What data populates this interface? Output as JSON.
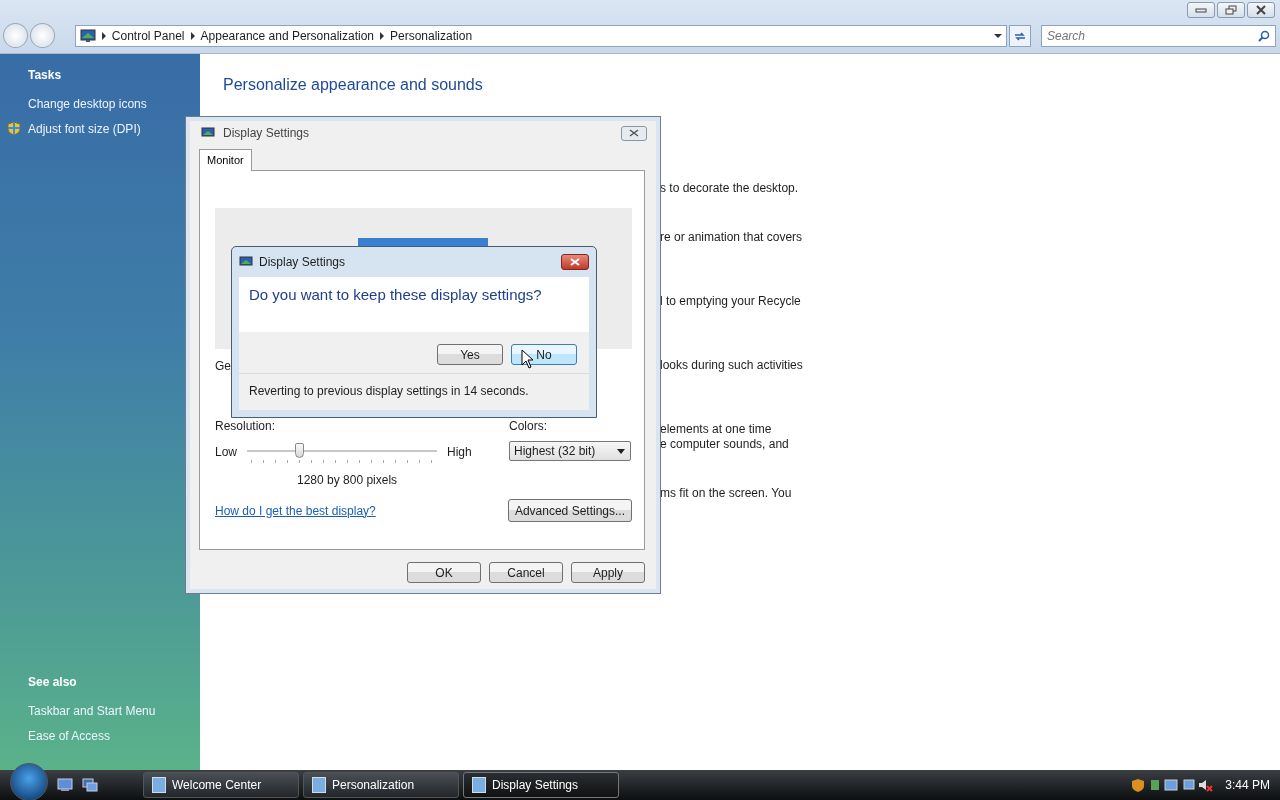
{
  "address_bar": {
    "breadcrumb": [
      "Control Panel",
      "Appearance and Personalization",
      "Personalization"
    ],
    "search": {
      "placeholder": "Search"
    }
  },
  "sidebar": {
    "sections": [
      {
        "title": "Tasks",
        "items": [
          {
            "label": "Change desktop icons",
            "kind": "link"
          },
          {
            "label": "Adjust font size (DPI)",
            "kind": "shield"
          }
        ]
      },
      {
        "title": "See also",
        "items": [
          {
            "label": "Taskbar and Start Menu",
            "kind": "link"
          },
          {
            "label": "Ease of Access",
            "kind": "link"
          }
        ]
      }
    ]
  },
  "main": {
    "heading": "Personalize appearance and sounds",
    "paragraphs": [
      [
        "s to decorate the desktop."
      ],
      [
        "re or animation that covers"
      ],
      [
        "l to emptying your Recycle"
      ],
      [
        "looks during such activities"
      ],
      [
        "elements at one time",
        "e computer sounds, and"
      ],
      [
        "ms fit on the screen. You"
      ]
    ]
  },
  "display_settings": {
    "title": "Display Settings",
    "tabs": [
      {
        "label": "Monitor"
      }
    ],
    "partial_label": "Ge",
    "resolution": {
      "label": "Resolution:",
      "low": "Low",
      "high": "High",
      "level": 0.28,
      "reading": "1280 by 800 pixels"
    },
    "colors": {
      "label": "Colors:",
      "value": "Highest (32 bit)"
    },
    "help_link": "How do I get the best display?",
    "advanced_button": "Advanced Settings...",
    "buttons": [
      "OK",
      "Cancel",
      "Apply"
    ]
  },
  "confirm": {
    "title": "Display Settings",
    "question": "Do you want to keep these display settings?",
    "buttons": [
      {
        "label": "Yes",
        "selected": false
      },
      {
        "label": "No",
        "selected": true
      }
    ],
    "countdown": "Reverting to previous display settings in 14 seconds."
  },
  "taskbar": {
    "tasks": [
      {
        "label": "Welcome Center",
        "selected": false
      },
      {
        "label": "Personalization",
        "selected": false
      },
      {
        "label": "Display Settings",
        "selected": true
      }
    ],
    "clock": "3:44 PM"
  }
}
